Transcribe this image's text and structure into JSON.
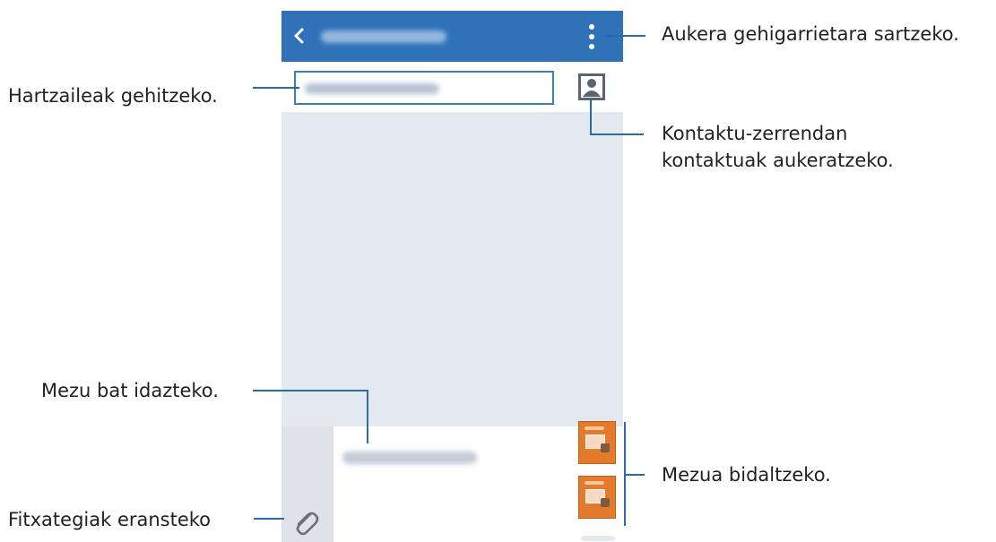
{
  "callouts": {
    "more_options": "Aukera gehigarrietara sartzeko.",
    "add_recipients": "Hartzaileak gehitzeko.",
    "contacts_line1": "Kontaktu-zerrendan",
    "contacts_line2": "kontaktuak aukeratzeko.",
    "write_message": "Mezu bat idazteko.",
    "send_message": "Mezua bidaltzeko.",
    "attach_files": "Fitxategiak eransteko"
  },
  "icons": {
    "back": "chevron-left-icon",
    "more": "more-vertical-icon",
    "contacts": "contact-person-icon",
    "attach": "paperclip-icon",
    "send": "send-message-icon"
  },
  "colors": {
    "appbar": "#2f72b8",
    "callout_line": "#2a6aae",
    "send_button": "#e37a2c",
    "canvas": "#e4e9f0"
  }
}
